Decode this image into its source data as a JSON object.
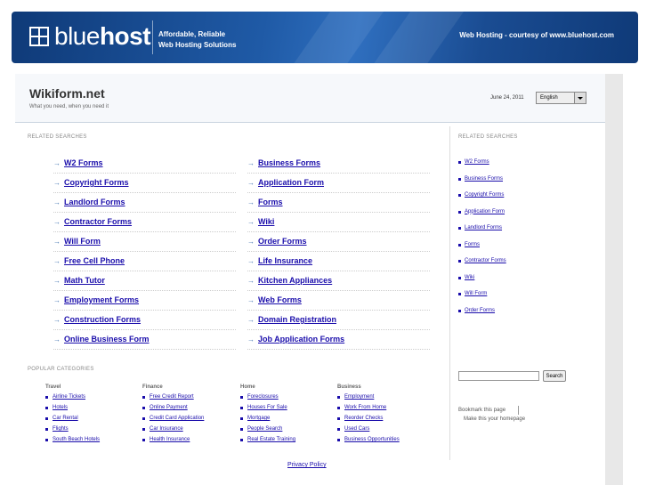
{
  "banner": {
    "logo_light": "blue",
    "logo_bold": "host",
    "tagline_1": "Affordable, Reliable",
    "tagline_2": "Web Hosting Solutions",
    "courtesy": "Web Hosting - courtesy of www.bluehost.com"
  },
  "header": {
    "title": "Wikiform.net",
    "subtitle": "What you need, when you need it",
    "date": "June 24, 2011",
    "language": "English"
  },
  "related": {
    "label": "RELATED SEARCHES",
    "left": [
      "W2 Forms",
      "Copyright Forms",
      "Landlord Forms",
      "Contractor Forms",
      "Will Form",
      "Free Cell Phone",
      "Math Tutor",
      "Employment Forms",
      "Construction Forms",
      "Online Business Form"
    ],
    "right": [
      "Business Forms",
      "Application Form",
      "Forms",
      "Wiki",
      "Order Forms",
      "Life Insurance",
      "Kitchen Appliances",
      "Web Forms",
      "Domain Registration",
      "Job Application Forms"
    ]
  },
  "sidebar": {
    "label": "RELATED SEARCHES",
    "items": [
      "W2 Forms",
      "Business Forms",
      "Copyright Forms",
      "Application Form",
      "Landlord Forms",
      "Forms",
      "Contractor Forms",
      "Wiki",
      "Will Form",
      "Order Forms"
    ],
    "search_button": "Search",
    "bookmark": "Bookmark this page",
    "homepage": "Make this your homepage"
  },
  "popular": {
    "label": "POPULAR CATEGORIES",
    "columns": [
      {
        "title": "Travel",
        "links": [
          "Airline Tickets",
          "Hotels",
          "Car Rental",
          "Flights",
          "South Beach Hotels"
        ]
      },
      {
        "title": "Finance",
        "links": [
          "Free Credit Report",
          "Online Payment",
          "Credit Card Application",
          "Car Insurance",
          "Health Insurance"
        ]
      },
      {
        "title": "Home",
        "links": [
          "Foreclosures",
          "Houses For Sale",
          "Mortgage",
          "People Search",
          "Real Estate Training"
        ]
      },
      {
        "title": "Business",
        "links": [
          "Employment",
          "Work From Home",
          "Reorder Checks",
          "Used Cars",
          "Business Opportunities"
        ]
      }
    ]
  },
  "footer": {
    "privacy": "Privacy Policy"
  }
}
